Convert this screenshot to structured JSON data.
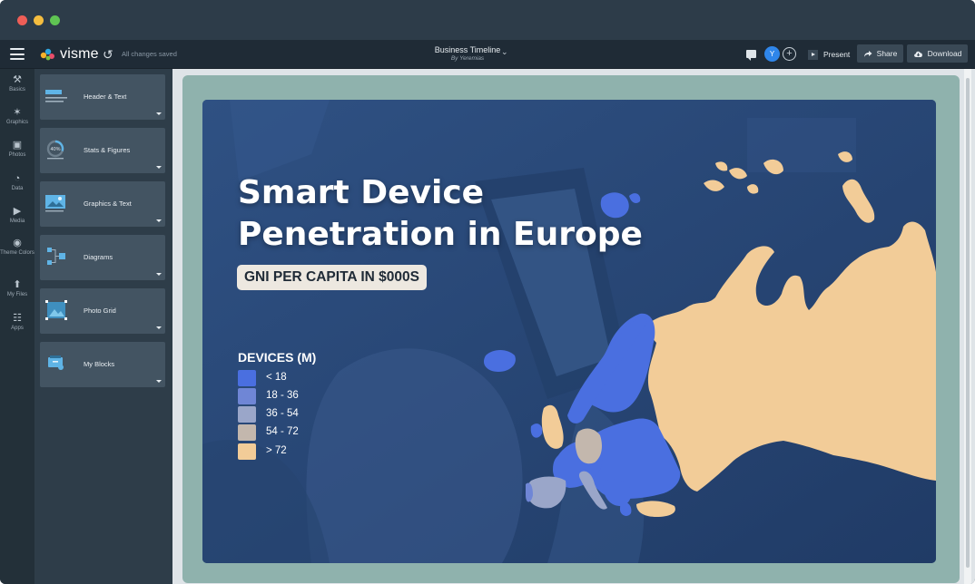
{
  "window": {
    "traffic_lights": [
      "close",
      "minimize",
      "zoom"
    ]
  },
  "toolbar": {
    "menu_icon": "hamburger-icon",
    "logo_text": "visme",
    "undo_icon": "undo-icon",
    "save_status": "All changes saved",
    "document_title": "Business Timeline",
    "document_author": "By Yeremias",
    "avatar_initial": "Y",
    "add_collaborator": "+",
    "present_label": "Present",
    "share_label": "Share",
    "download_label": "Download"
  },
  "rail": {
    "items": [
      {
        "label": "Basics",
        "icon": "basics-icon"
      },
      {
        "label": "Graphics",
        "icon": "graphics-icon"
      },
      {
        "label": "Photos",
        "icon": "photos-icon"
      },
      {
        "label": "Data",
        "icon": "data-icon"
      },
      {
        "label": "Media",
        "icon": "media-icon"
      },
      {
        "label": "Theme Colors",
        "icon": "palette-icon"
      },
      {
        "label": "My Files",
        "icon": "upload-icon"
      },
      {
        "label": "Apps",
        "icon": "apps-icon"
      }
    ]
  },
  "panel": {
    "cards": [
      {
        "label": "Header & Text",
        "thumb": "header-text-thumb"
      },
      {
        "label": "Stats & Figures",
        "thumb": "stats-thumb",
        "thumb_text": "40%"
      },
      {
        "label": "Graphics & Text",
        "thumb": "graphics-text-thumb"
      },
      {
        "label": "Diagrams",
        "thumb": "diagrams-thumb"
      },
      {
        "label": "Photo Grid",
        "thumb": "photo-grid-thumb"
      },
      {
        "label": "My Blocks",
        "thumb": "my-blocks-thumb"
      }
    ]
  },
  "slide": {
    "title_line1": "Smart Device",
    "title_line2": "Penetration in Europe",
    "subtitle_pill": "GNI PER CAPITA IN $000S",
    "legend": {
      "title": "DEVICES (M)",
      "items": [
        {
          "label": "< 18",
          "color": "#4a6fe0"
        },
        {
          "label": "18 - 36",
          "color": "#6f86d6"
        },
        {
          "label": "36 - 54",
          "color": "#9aa6c9"
        },
        {
          "label": "54 - 72",
          "color": "#c3b7ad"
        },
        {
          "label": "> 72",
          "color": "#f2cc98"
        }
      ]
    }
  },
  "colors": {
    "slide_border": "#8fb2ad",
    "slide_background": "#2c4b7a",
    "russia": "#f2cc98",
    "europe_main": "#4a6fe0"
  }
}
